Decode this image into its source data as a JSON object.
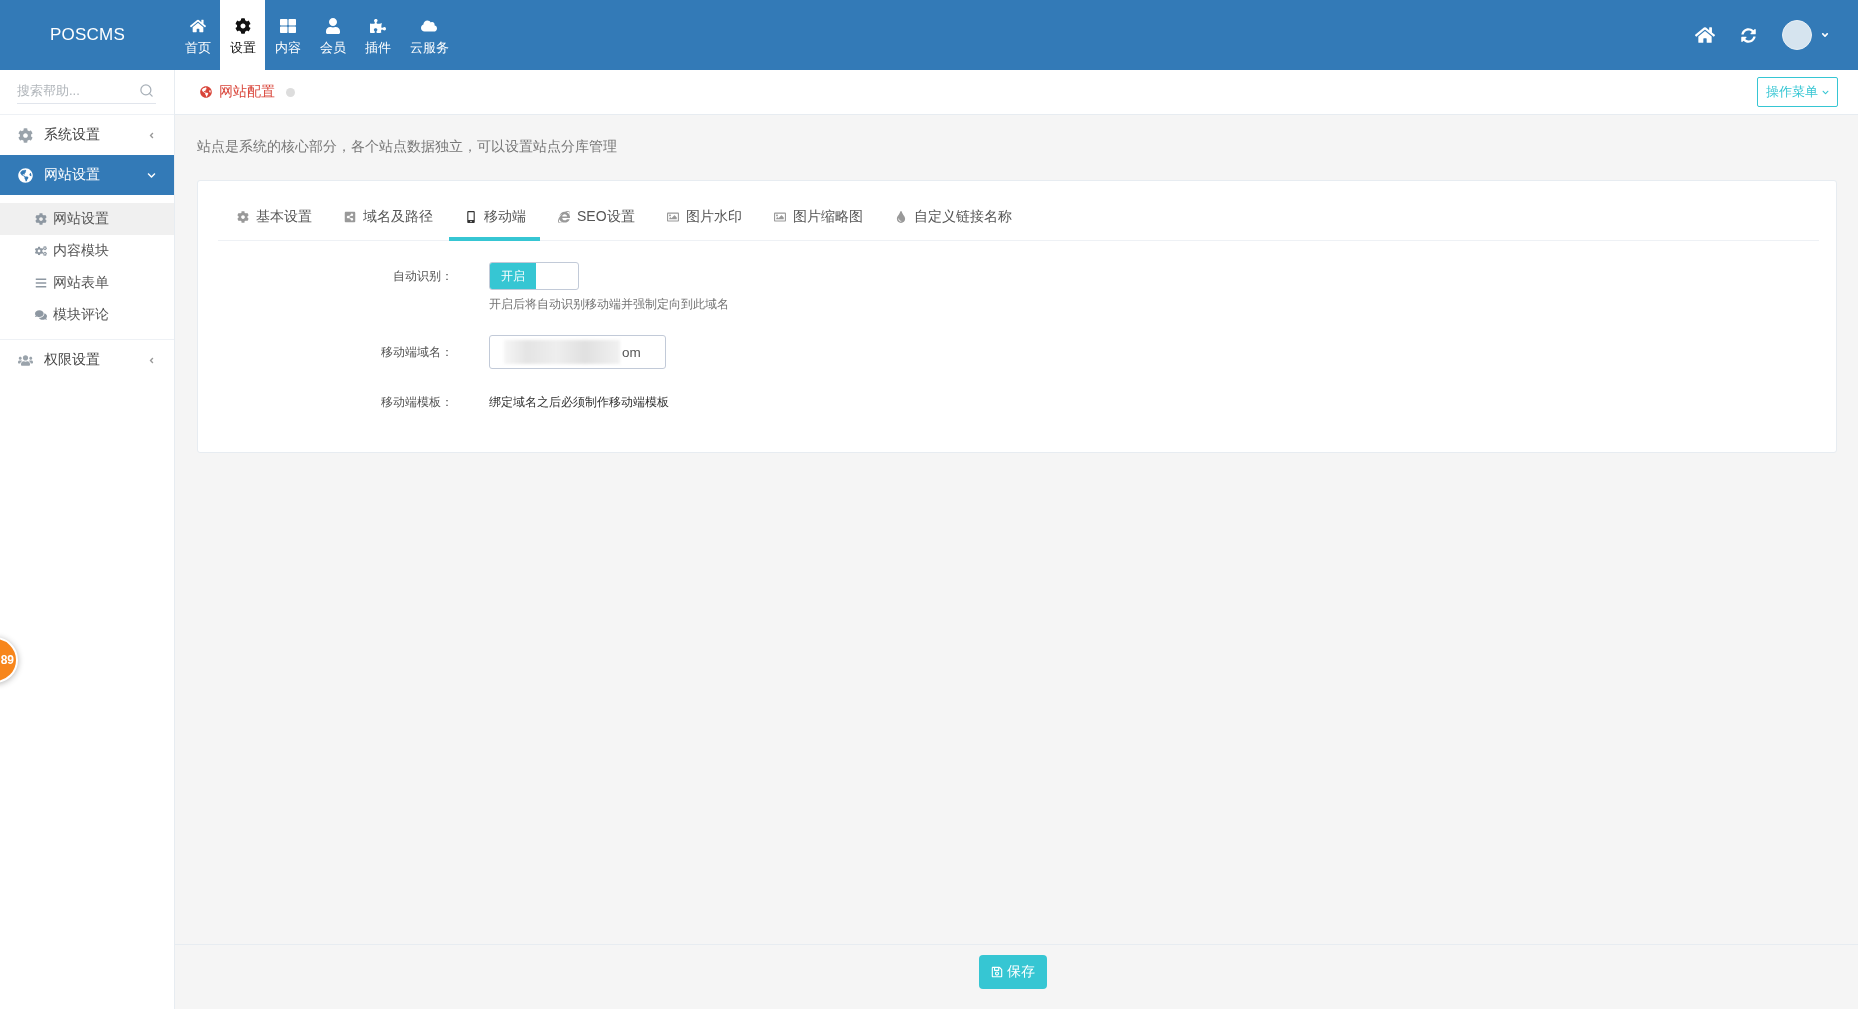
{
  "top_bar": {
    "logo": "POSCMS",
    "nav": [
      {
        "label": "首页",
        "selected": false
      },
      {
        "label": "设置",
        "selected": true
      },
      {
        "label": "内容",
        "selected": false
      },
      {
        "label": "会员",
        "selected": false
      },
      {
        "label": "插件",
        "selected": false
      },
      {
        "label": "云服务",
        "selected": false
      }
    ]
  },
  "sidebar": {
    "search": {
      "placeholder": "搜索帮助..."
    },
    "groups": [
      {
        "label": "系统设置",
        "selected": false,
        "expanded": false
      },
      {
        "label": "网站设置",
        "selected": true,
        "expanded": true,
        "children": [
          {
            "label": "网站设置",
            "selected": true
          },
          {
            "label": "内容模块",
            "selected": false
          },
          {
            "label": "网站表单",
            "selected": false
          },
          {
            "label": "模块评论",
            "selected": false
          }
        ]
      },
      {
        "label": "权限设置",
        "selected": false,
        "expanded": false
      }
    ]
  },
  "breadcrumb": {
    "label": "网站配置",
    "menu_button": "操作菜单"
  },
  "description": "站点是系统的核心部分，各个站点数据独立，可以设置站点分库管理",
  "tabs": [
    {
      "label": "基本设置",
      "selected": false
    },
    {
      "label": "域名及路径",
      "selected": false
    },
    {
      "label": "移动端",
      "selected": true
    },
    {
      "label": "SEO设置",
      "selected": false
    },
    {
      "label": "图片水印",
      "selected": false
    },
    {
      "label": "图片缩略图",
      "selected": false
    },
    {
      "label": "自定义链接名称",
      "selected": false
    }
  ],
  "form": {
    "fields": [
      {
        "kind": "switch",
        "label": "自动识别：",
        "on": true,
        "on_label": "开启",
        "help": "开启后将自动识别移动端并强制定向到此域名"
      },
      {
        "kind": "input",
        "label": "移动端域名：",
        "value": "om"
      },
      {
        "kind": "text",
        "label": "移动端模板：",
        "text": "绑定域名之后必须制作移动端模板"
      }
    ]
  },
  "save_button": "保存",
  "floating_badge": "89"
}
